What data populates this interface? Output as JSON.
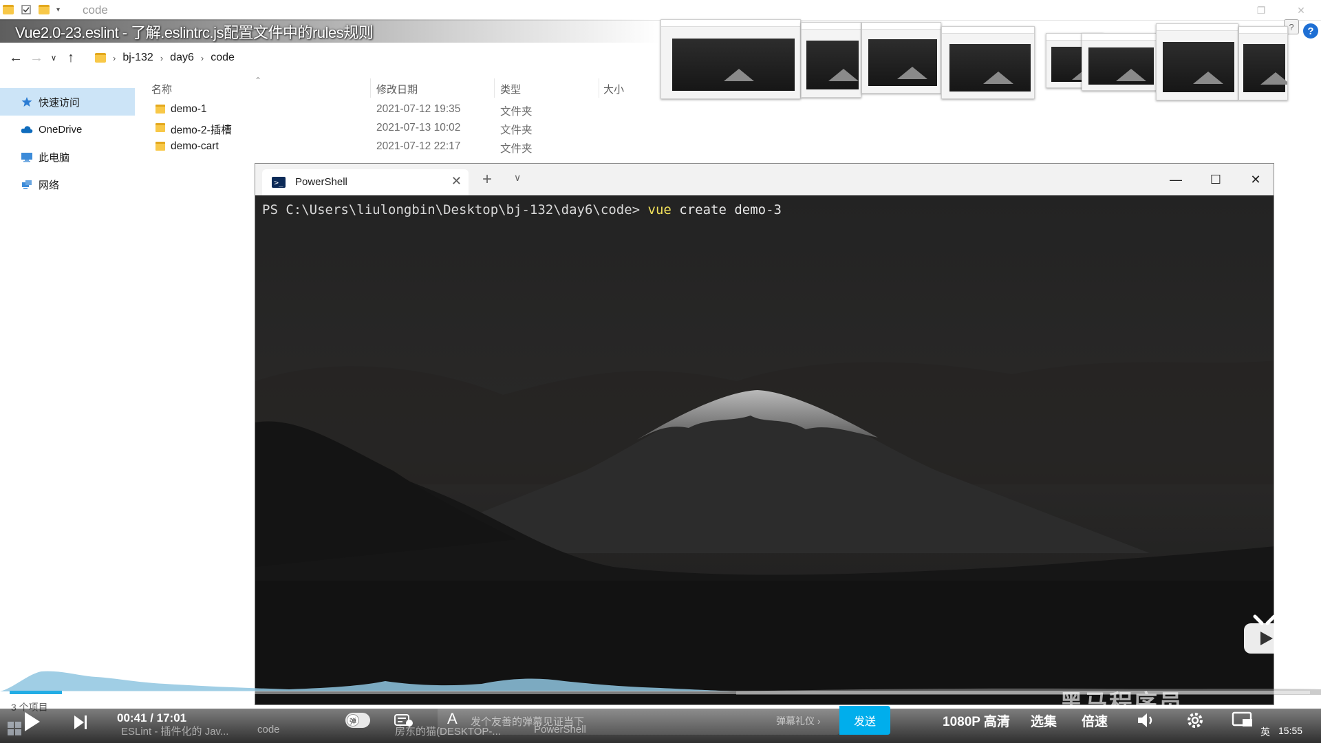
{
  "quick_access_toolbar": {
    "title": "code"
  },
  "video": {
    "title": "Vue2.0-23.eslint - 了解.eslintrc.js配置文件中的rules规则"
  },
  "explorer": {
    "breadcrumb": [
      "bj-132",
      "day6",
      "code"
    ],
    "sidebar": [
      {
        "label": "快速访问",
        "icon": "star-icon"
      },
      {
        "label": "OneDrive",
        "icon": "cloud-icon"
      },
      {
        "label": "此电脑",
        "icon": "computer-icon"
      },
      {
        "label": "网络",
        "icon": "network-icon"
      }
    ],
    "columns": {
      "name": "名称",
      "modified": "修改日期",
      "type": "类型",
      "size": "大小"
    },
    "files": [
      {
        "name": "demo-1",
        "modified": "2021-07-12 19:35",
        "type": "文件夹"
      },
      {
        "name": "demo-2-插槽",
        "modified": "2021-07-13 10:02",
        "type": "文件夹"
      },
      {
        "name": "demo-cart",
        "modified": "2021-07-12 22:17",
        "type": "文件夹"
      }
    ],
    "status": "3 个项目"
  },
  "powershell": {
    "tab_label": "PowerShell",
    "prompt": "PS C:\\Users\\liulongbin\\Desktop\\bj-132\\day6\\code> ",
    "command": "vue",
    "args": " create demo-3"
  },
  "player": {
    "current_time": "00:41",
    "total_time": "17:01",
    "time_display": "00:41 / 17:01",
    "progress": 0.04,
    "danmu_placeholder": "发个友善的弹幕见证当下",
    "etiquette": "弹幕礼仪 ›",
    "send_label": "发送",
    "quality": "1080P 高清",
    "episodes": "选集",
    "speed": "倍速",
    "watermark": "黑马程序员"
  },
  "taskbar": {
    "items": [
      "ESLint - 插件化的 Jav...",
      "code",
      "房东的猫(DESKTOP-...",
      "PowerShell"
    ],
    "ime": "英",
    "clock": "15:55"
  },
  "colors": {
    "accent": "#00aeec",
    "progress": "#23ade5",
    "selection": "#cce4f7",
    "folder": "#f8c848",
    "ps_command": "#f1e05a"
  }
}
